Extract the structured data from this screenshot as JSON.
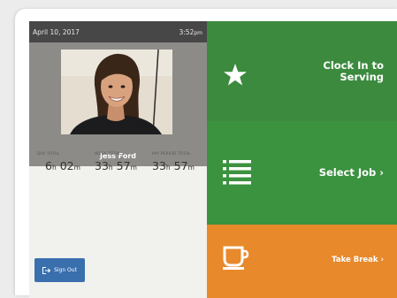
{
  "status": {
    "date": "April 10, 2017",
    "time": "3:52",
    "ampm": "pm"
  },
  "user": {
    "name": "Jess Ford"
  },
  "totals": [
    {
      "label": "DAY TOTAL",
      "hours": "6",
      "minutes": "02"
    },
    {
      "label": "WEEK TOTAL",
      "hours": "33",
      "minutes": "57"
    },
    {
      "label": "PAY PERIOD TOTAL",
      "hours": "33",
      "minutes": "57"
    }
  ],
  "units": {
    "h": "h",
    "m": "m"
  },
  "buttons": {
    "sign_out": "Sign Out",
    "clock_in_line1": "Clock In to",
    "clock_in_line2": "Serving",
    "select_job": "Select Job ›",
    "take_break": "Take Break ›"
  },
  "icons": {
    "clock_in": "star-icon",
    "select_job": "list-icon",
    "take_break": "coffee-cup-icon",
    "sign_out": "sign-out-icon"
  },
  "colors": {
    "clock_in_tile": "#3b8a3e",
    "select_job_tile": "#3b923f",
    "take_break_tile": "#e8892b",
    "sign_out_button": "#3a6fae",
    "status_bar": "#474747"
  }
}
